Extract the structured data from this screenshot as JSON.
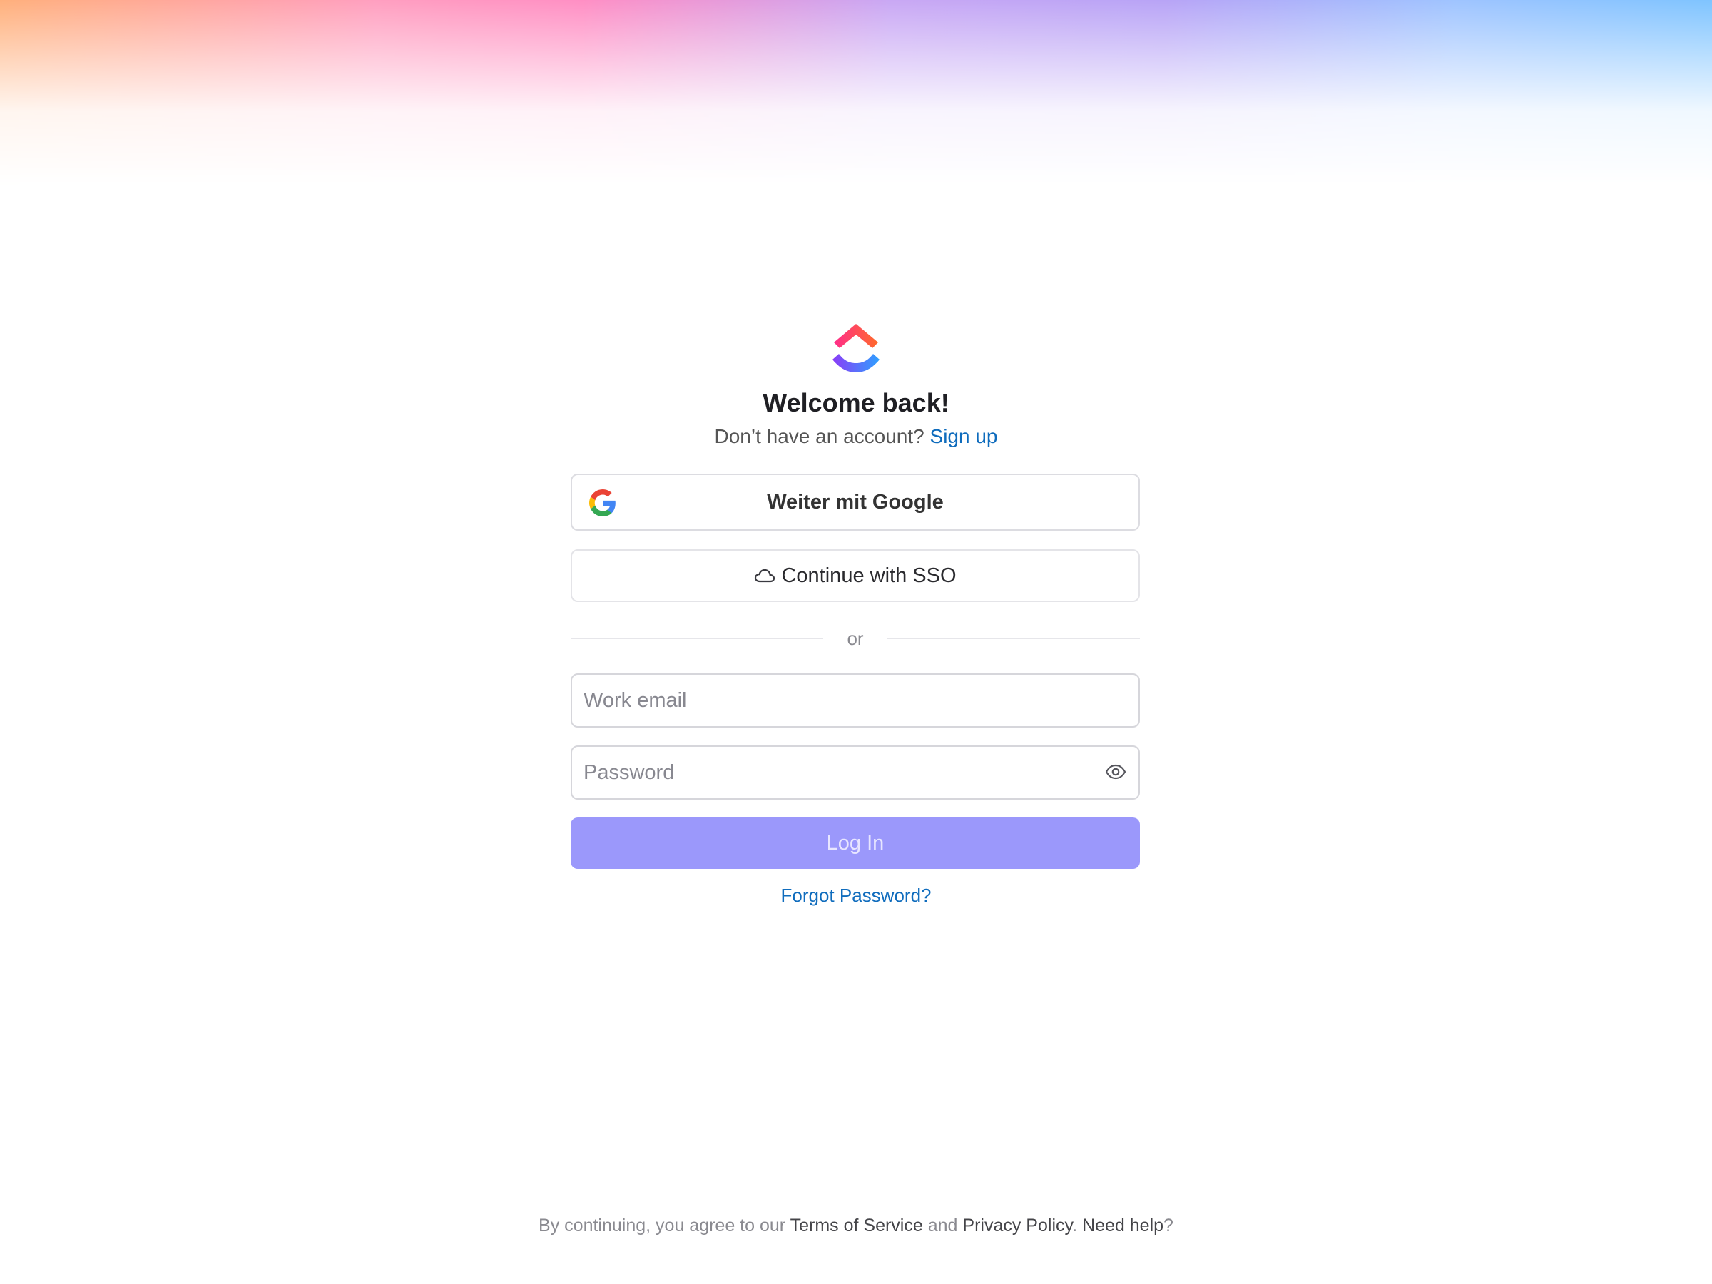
{
  "brand": {
    "logo_icon": "clickup-logo-icon",
    "colors": {
      "gradient_top": [
        "#ff6a2b",
        "#ff2d8a"
      ],
      "gradient_bottom": [
        "#8b3cf7",
        "#2ea0ff"
      ],
      "link": "#0f6cbd",
      "login_button_bg": "#9b98fb",
      "login_button_text": "#e8e6ff"
    }
  },
  "header": {
    "title": "Welcome back!",
    "signup_prompt": "Don’t have an account?",
    "signup_link": "Sign up"
  },
  "oauth": {
    "google_label": "Weiter mit Google",
    "google_icon": "google-icon",
    "sso_label": "Continue with SSO",
    "sso_icon": "cloud-icon"
  },
  "divider": {
    "text": "or"
  },
  "form": {
    "email": {
      "placeholder": "Work email",
      "value": ""
    },
    "password": {
      "placeholder": "Password",
      "value": "",
      "toggle_icon": "eye-icon"
    },
    "login_label": "Log In",
    "forgot_label": "Forgot Password?"
  },
  "footer": {
    "prefix": "By continuing, you agree to our",
    "terms": "Terms of Service",
    "and": "and",
    "privacy": "Privacy Policy",
    "period": ".",
    "help": "Need help",
    "help_suffix": "?"
  }
}
